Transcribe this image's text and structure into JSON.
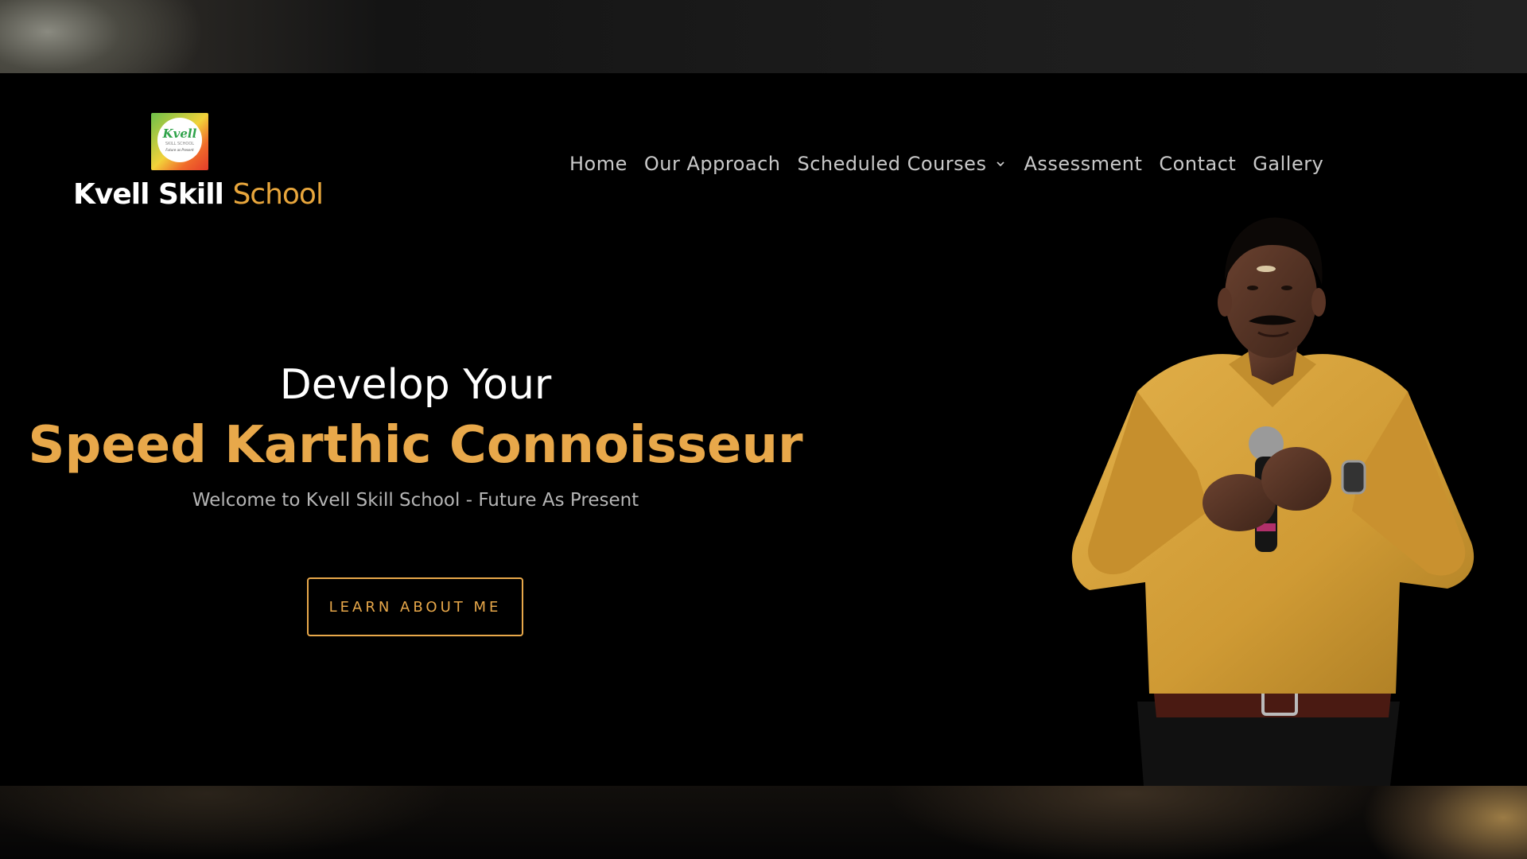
{
  "brand": {
    "name_white": "Kvell Skill",
    "name_orange": "School",
    "logo_mark": "Kvell",
    "logo_subline": "SKILL SCHOOL",
    "logo_tagline": "Future as Present"
  },
  "nav": {
    "items": [
      {
        "label": "Home"
      },
      {
        "label": "Our Approach"
      },
      {
        "label": "Scheduled Courses",
        "icon": "chevron-down-icon"
      },
      {
        "label": "Assessment"
      },
      {
        "label": "Contact"
      },
      {
        "label": "Gallery"
      }
    ]
  },
  "hero": {
    "line1": "Develop Your",
    "line2": "Speed Karthic Connoisseur",
    "subtitle": "Welcome to Kvell Skill School - Future As Present",
    "cta_label": "LEARN ABOUT ME"
  },
  "colors": {
    "accent": "#e8a84a",
    "background": "#000000",
    "nav_text": "#c9c9c9",
    "shirt": "#d9a63a"
  }
}
